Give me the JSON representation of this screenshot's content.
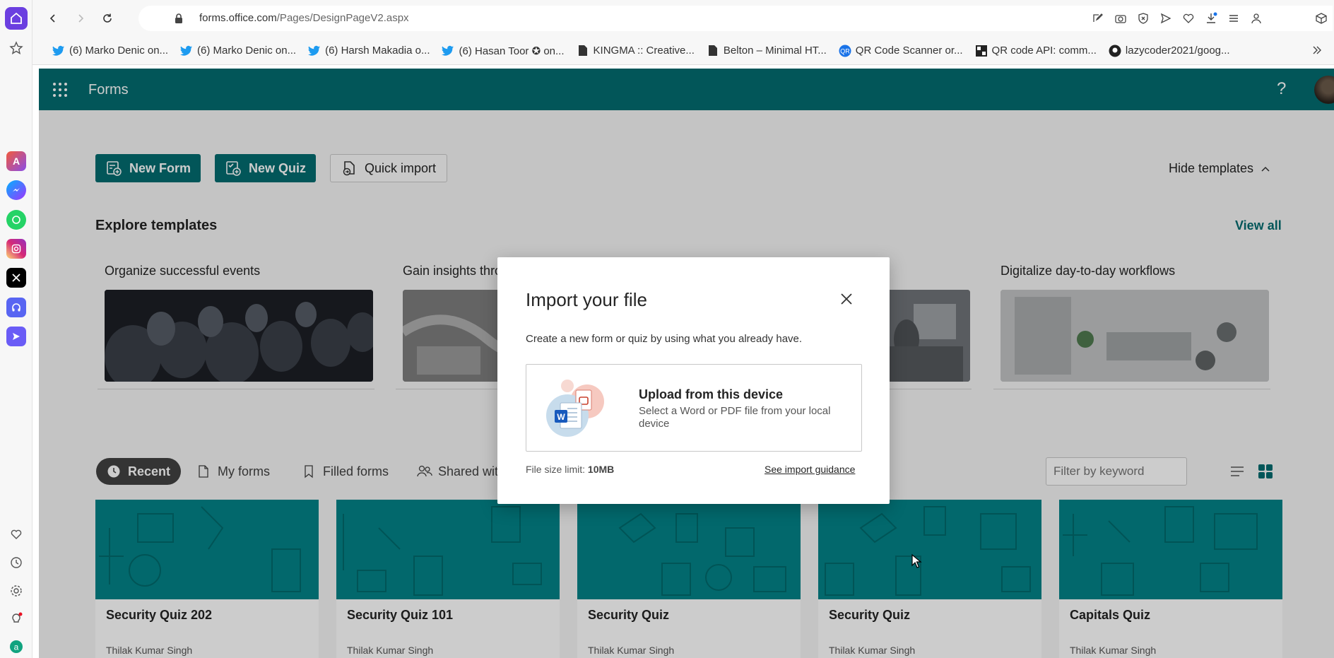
{
  "browser": {
    "url_host": "forms.office.com",
    "url_path": "/Pages/DesignPageV2.aspx",
    "bookmarks": [
      {
        "label": "(6) Marko Denic on...",
        "icon": "twitter-bird-icon"
      },
      {
        "label": "(6) Marko Denic on...",
        "icon": "twitter-bird-icon"
      },
      {
        "label": "(6) Harsh Makadia o...",
        "icon": "twitter-bird-icon"
      },
      {
        "label": "(6) Hasan Toor ✪ on...",
        "icon": "twitter-bird-icon"
      },
      {
        "label": "KINGMA :: Creative...",
        "icon": "page-icon"
      },
      {
        "label": "Belton – Minimal HT...",
        "icon": "page-icon"
      },
      {
        "label": "QR Code Scanner or...",
        "icon": "qr-icon"
      },
      {
        "label": "QR code API: comm...",
        "icon": "qr-code-icon"
      },
      {
        "label": "lazycoder2021/goog...",
        "icon": "github-icon"
      }
    ]
  },
  "app": {
    "name": "Forms",
    "help": "?",
    "actions": {
      "new_form": "New Form",
      "new_quiz": "New Quiz",
      "quick_import": "Quick import"
    },
    "hide_templates": "Hide templates",
    "explore_title": "Explore templates",
    "view_all": "View all",
    "templates": [
      {
        "title": "Organize successful events"
      },
      {
        "title": "Gain insights thro"
      },
      {
        "title": ""
      },
      {
        "title": "Digitalize day-to-day workflows"
      }
    ],
    "pivots": {
      "recent": "Recent",
      "my_forms": "My forms",
      "filled_forms": "Filled forms",
      "shared": "Shared wit"
    },
    "filter_placeholder": "Filter by keyword",
    "cards": [
      {
        "title": "Security Quiz 202",
        "owner": "Thilak Kumar Singh"
      },
      {
        "title": "Security Quiz 101",
        "owner": "Thilak Kumar Singh"
      },
      {
        "title": "Security Quiz",
        "owner": "Thilak Kumar Singh"
      },
      {
        "title": "Security Quiz",
        "owner": "Thilak Kumar Singh"
      },
      {
        "title": "Capitals Quiz",
        "owner": "Thilak Kumar Singh"
      }
    ]
  },
  "dialog": {
    "title": "Import your file",
    "subtitle": "Create a new form or quiz by using what you already have.",
    "upload_title": "Upload from this device",
    "upload_desc": "Select a Word or PDF file from your local device",
    "size_label": "File size limit:",
    "size_value": "10MB",
    "guidance": "See import guidance"
  },
  "colors": {
    "brand": "#036c70",
    "card_banner": "#038387"
  }
}
